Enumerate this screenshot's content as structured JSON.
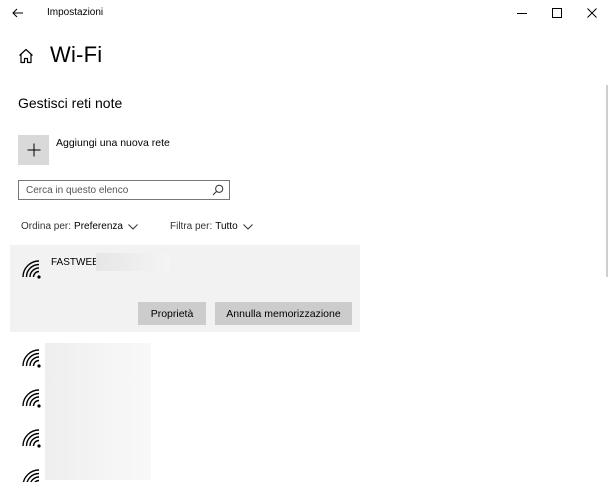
{
  "window": {
    "title": "Impostazioni",
    "controls": [
      "minimize",
      "maximize",
      "close"
    ]
  },
  "page": {
    "title": "Wi-Fi",
    "section_title": "Gestisci reti note"
  },
  "add_network": {
    "label": "Aggiungi una nuova rete",
    "icon": "plus-icon"
  },
  "search": {
    "placeholder": "Cerca in questo elenco",
    "value": "",
    "icon": "search-icon"
  },
  "sort": {
    "label": "Ordina per:",
    "value": "Preferenza"
  },
  "filter": {
    "label": "Filtra per:",
    "value": "Tutto"
  },
  "networks": {
    "selected": {
      "name": "FASTWEB",
      "icon": "wifi-icon",
      "buttons": {
        "properties": "Proprietà",
        "forget": "Annulla memorizzazione"
      }
    },
    "others_icon": "wifi-icon"
  },
  "colors": {
    "selected_bg": "#f2f2f2",
    "button_bg": "#cccccc",
    "add_tile_bg": "#d9d9d9"
  }
}
